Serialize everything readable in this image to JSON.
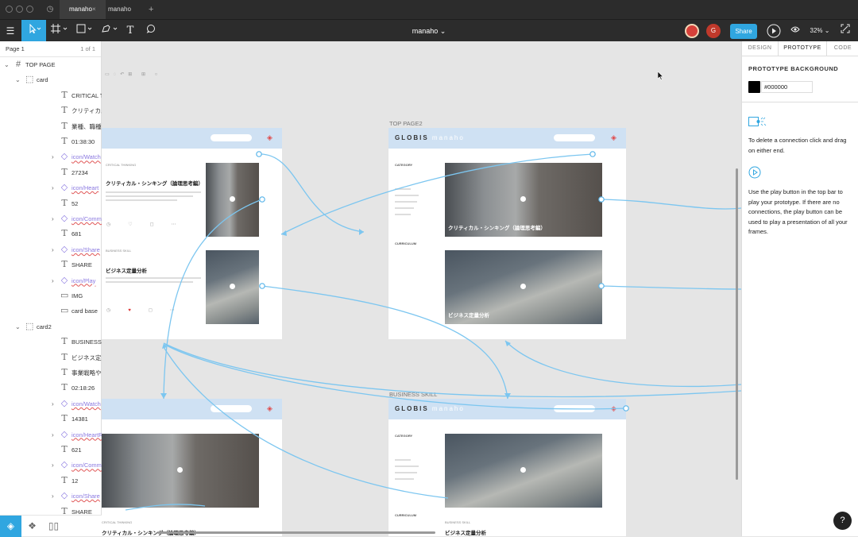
{
  "tabs": [
    {
      "label": "manaho",
      "active": true
    },
    {
      "label": "manaho",
      "active": false
    }
  ],
  "tab_close": "×",
  "tab_add": "+",
  "toolbar": {
    "doc_title": "manaho",
    "share_label": "Share",
    "user_initial": "G",
    "zoom": "32%"
  },
  "layers": {
    "page_label": "Page 1",
    "page_count": "1 of 1",
    "items": [
      {
        "label": "TOP PAGE",
        "type": "frame"
      },
      {
        "label": "card",
        "type": "group"
      },
      {
        "label": "CRITICAL THINKI...",
        "type": "text"
      },
      {
        "label": "クリティカル・シ...",
        "type": "text"
      },
      {
        "label": "業種、職種、役職...",
        "type": "text"
      },
      {
        "label": "01:38:30",
        "type": "text"
      },
      {
        "label": "icon/Watch",
        "type": "instance"
      },
      {
        "label": "27234",
        "type": "text"
      },
      {
        "label": "icon/Heart",
        "type": "instance"
      },
      {
        "label": "52",
        "type": "text"
      },
      {
        "label": "icon/Comment",
        "type": "instance"
      },
      {
        "label": "681",
        "type": "text"
      },
      {
        "label": "icon/Share",
        "type": "instance"
      },
      {
        "label": "SHARE",
        "type": "text"
      },
      {
        "label": "icon/Play",
        "type": "instance"
      },
      {
        "label": "IMG",
        "type": "rect"
      },
      {
        "label": "card base",
        "type": "rect"
      },
      {
        "label": "card2",
        "type": "group"
      },
      {
        "label": "BUSINESS SKILL",
        "type": "text"
      },
      {
        "label": "ビジネス定量分析",
        "type": "text"
      },
      {
        "label": "事業戦略や企画立...",
        "type": "text"
      },
      {
        "label": "02:18:26",
        "type": "text"
      },
      {
        "label": "icon/Watch",
        "type": "instance"
      },
      {
        "label": "14381",
        "type": "text"
      },
      {
        "label": "icon/HeartRed",
        "type": "instance"
      },
      {
        "label": "621",
        "type": "text"
      },
      {
        "label": "icon/Comment",
        "type": "instance"
      },
      {
        "label": "12",
        "type": "text"
      },
      {
        "label": "icon/Share",
        "type": "instance"
      },
      {
        "label": "SHARE",
        "type": "text"
      }
    ]
  },
  "canvas": {
    "frames": [
      {
        "label": "TOP PAGE2"
      },
      {
        "label": "BUSINESS SKILL"
      }
    ],
    "logo": "GLOBIS",
    "logo_sub": "manaho",
    "category_label": "CATEGORY",
    "curriculum_label": "CURRICULUM",
    "cards": {
      "critical_category": "CRITICAL THINKING",
      "critical_title": "クリティカル・シンキング（論理思考編）",
      "business_category": "BUSINESS SKILL",
      "business_title": "ビジネス定量分析"
    }
  },
  "prototype_panel": {
    "tabs": [
      "DESIGN",
      "PROTOTYPE",
      "CODE"
    ],
    "active_tab": "PROTOTYPE",
    "heading": "PROTOTYPE BACKGROUND",
    "background_hex": "#000000",
    "hint_delete": "To delete a connection click and drag on either end.",
    "hint_play": "Use the play button in the top bar to play your prototype. If there are no connections, the play button can be used to play a presentation of all your frames."
  },
  "colors": {
    "accent": "#30a6e0",
    "wire": "#7cc6f0",
    "header_blue": "#cfe1f3",
    "badge_red": "#e04848"
  },
  "help_label": "?"
}
